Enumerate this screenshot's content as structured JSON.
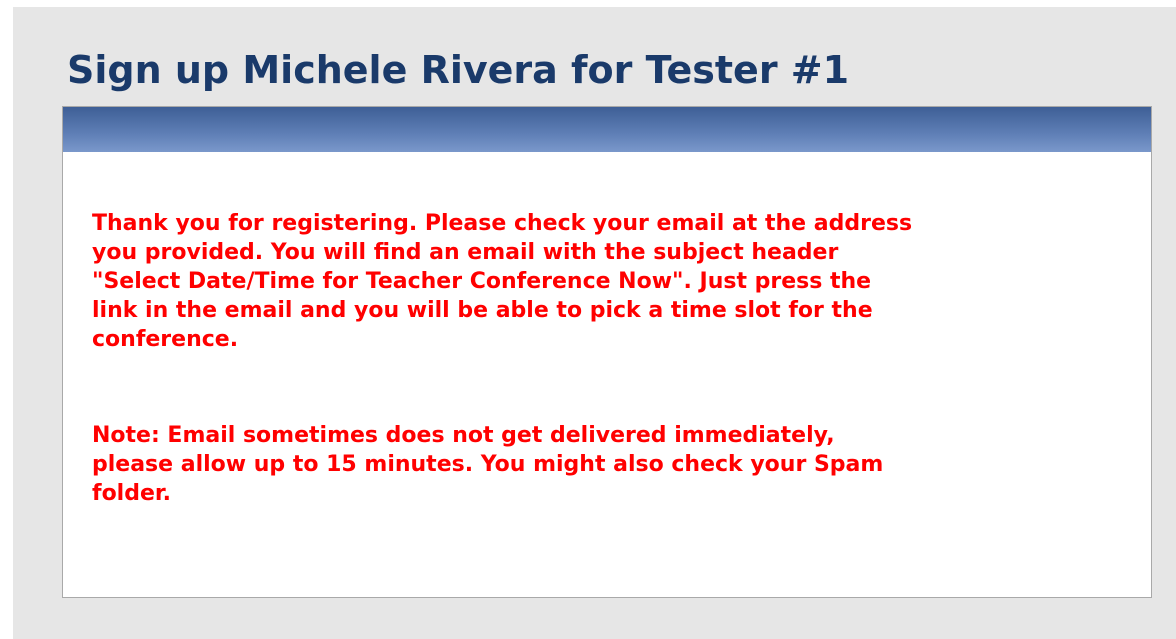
{
  "page": {
    "title": "Sign up Michele Rivera for Tester #1"
  },
  "panel": {
    "message_lines": [
      "Thank you for registering. Please check your email at the address",
      "you provided. You will find an email with the subject header",
      "\"Select Date/Time for Teacher Conference Now\". Just press the",
      "link in the email and you will be able to pick a time slot for the",
      "conference."
    ],
    "note_lines": [
      "Note: Email sometimes does not get delivered immediately,",
      "please allow up to 15 minutes. You might also check your Spam",
      "folder."
    ]
  },
  "colors": {
    "title": "#1a3a6a",
    "header_bar": "#4e6fa6",
    "message_text": "#ff0000",
    "page_background": "#e6e6e6",
    "panel_background": "#ffffff"
  }
}
